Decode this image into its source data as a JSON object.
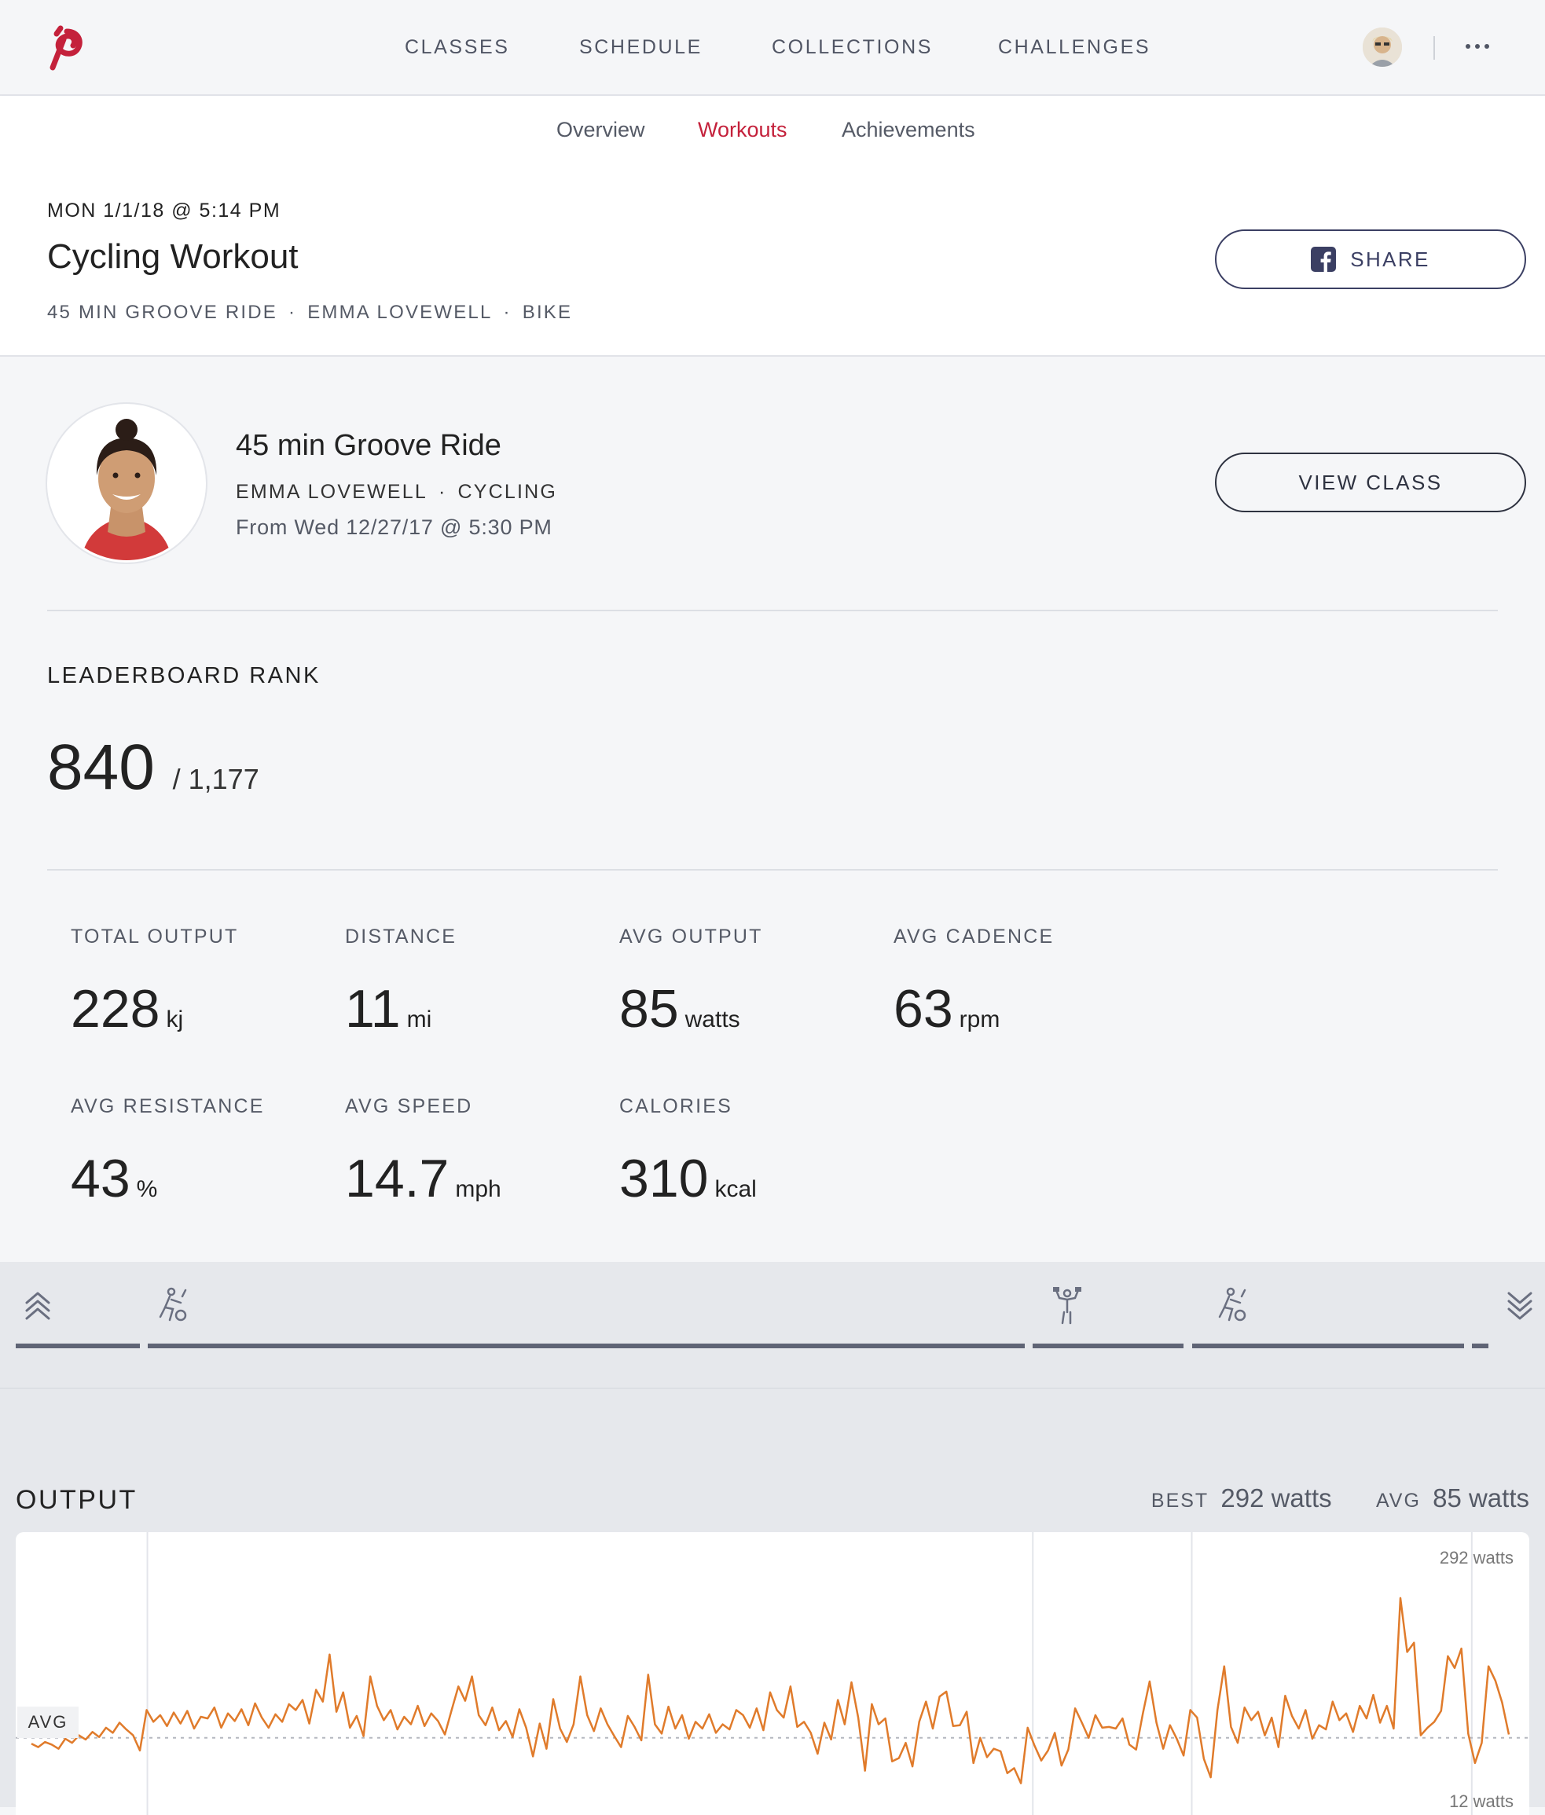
{
  "nav": {
    "items": [
      "CLASSES",
      "SCHEDULE",
      "COLLECTIONS",
      "CHALLENGES"
    ]
  },
  "subnav": {
    "items": [
      "Overview",
      "Workouts",
      "Achievements"
    ],
    "active": "Workouts"
  },
  "workout": {
    "date": "MON 1/1/18 @ 5:14 PM",
    "title": "Cycling Workout",
    "meta": [
      "45 MIN GROOVE RIDE",
      "EMMA LOVEWELL",
      "BIKE"
    ],
    "share_label": "SHARE"
  },
  "class": {
    "title": "45 min Groove Ride",
    "instructor": "EMMA LOVEWELL",
    "discipline": "CYCLING",
    "from": "From Wed 12/27/17 @ 5:30 PM",
    "view_label": "VIEW CLASS"
  },
  "leaderboard": {
    "label": "LEADERBOARD RANK",
    "rank": "840",
    "total": "/ 1,177"
  },
  "stats": [
    {
      "label": "TOTAL OUTPUT",
      "value": "228",
      "unit": "kj"
    },
    {
      "label": "DISTANCE",
      "value": "11",
      "unit": "mi"
    },
    {
      "label": "AVG OUTPUT",
      "value": "85",
      "unit": "watts"
    },
    {
      "label": "AVG CADENCE",
      "value": "63",
      "unit": "rpm"
    },
    {
      "label": "AVG RESISTANCE",
      "value": "43",
      "unit": "%"
    },
    {
      "label": "AVG SPEED",
      "value": "14.7",
      "unit": "mph"
    },
    {
      "label": "CALORIES",
      "value": "310",
      "unit": "kcal"
    }
  ],
  "segments": [
    {
      "icon": "warmup-icon",
      "fraction": 0.087
    },
    {
      "icon": "cycling-icon",
      "fraction": 0.585
    },
    {
      "icon": "arms-weights-icon",
      "fraction": 0.105
    },
    {
      "icon": "cycling-icon",
      "fraction": 0.185
    },
    {
      "icon": "cooldown-icon",
      "fraction": 0.016
    }
  ],
  "output": {
    "label": "OUTPUT",
    "best_label": "BEST",
    "best_value": "292 watts",
    "avg_label": "AVG",
    "avg_value": "85 watts",
    "chart_max_label": "292 watts",
    "chart_min_label": "12 watts",
    "avg_tag": "AVG",
    "line_color": "#e07b2b"
  },
  "chart_data": {
    "type": "line",
    "title": "OUTPUT",
    "ylim": [
      12,
      292
    ],
    "avg": 85,
    "values": [
      78,
      74,
      80,
      77,
      72,
      84,
      79,
      88,
      83,
      92,
      86,
      97,
      91,
      103,
      95,
      88,
      70,
      118,
      104,
      112,
      99,
      115,
      102,
      117,
      96,
      110,
      108,
      121,
      97,
      114,
      105,
      119,
      100,
      126,
      109,
      97,
      113,
      104,
      125,
      118,
      130,
      102,
      142,
      128,
      184,
      116,
      139,
      97,
      111,
      87,
      158,
      123,
      106,
      118,
      95,
      110,
      101,
      123,
      99,
      114,
      105,
      89,
      118,
      146,
      129,
      158,
      112,
      100,
      121,
      94,
      105,
      86,
      119,
      97,
      63,
      102,
      72,
      131,
      96,
      80,
      101,
      158,
      112,
      93,
      120,
      101,
      87,
      74,
      111,
      98,
      82,
      160,
      101,
      90,
      122,
      96,
      112,
      84,
      104,
      96,
      113,
      91,
      101,
      95,
      118,
      112,
      97,
      120,
      94,
      139,
      118,
      109,
      146,
      98,
      104,
      91,
      66,
      103,
      83,
      130,
      101,
      151,
      109,
      46,
      125,
      101,
      108,
      57,
      61,
      79,
      51,
      104,
      128,
      96,
      134,
      140,
      99,
      100,
      116,
      55,
      85,
      62,
      72,
      69,
      43,
      49,
      31,
      97,
      76,
      58,
      70,
      91,
      52,
      71,
      120,
      103,
      85,
      112,
      97,
      98,
      96,
      108,
      77,
      71,
      114,
      152,
      103,
      72,
      100,
      84,
      64,
      118,
      109,
      60,
      38,
      118,
      170,
      98,
      79,
      121,
      106,
      116,
      88,
      109,
      74,
      135,
      111,
      96,
      118,
      84,
      100,
      95,
      128,
      106,
      114,
      92,
      123,
      108,
      136,
      103,
      123,
      96,
      251,
      187,
      198,
      88,
      97,
      104,
      117,
      182,
      168,
      191,
      90,
      55,
      79,
      170,
      153,
      127,
      89
    ],
    "xlabel": "",
    "ylabel": ""
  }
}
